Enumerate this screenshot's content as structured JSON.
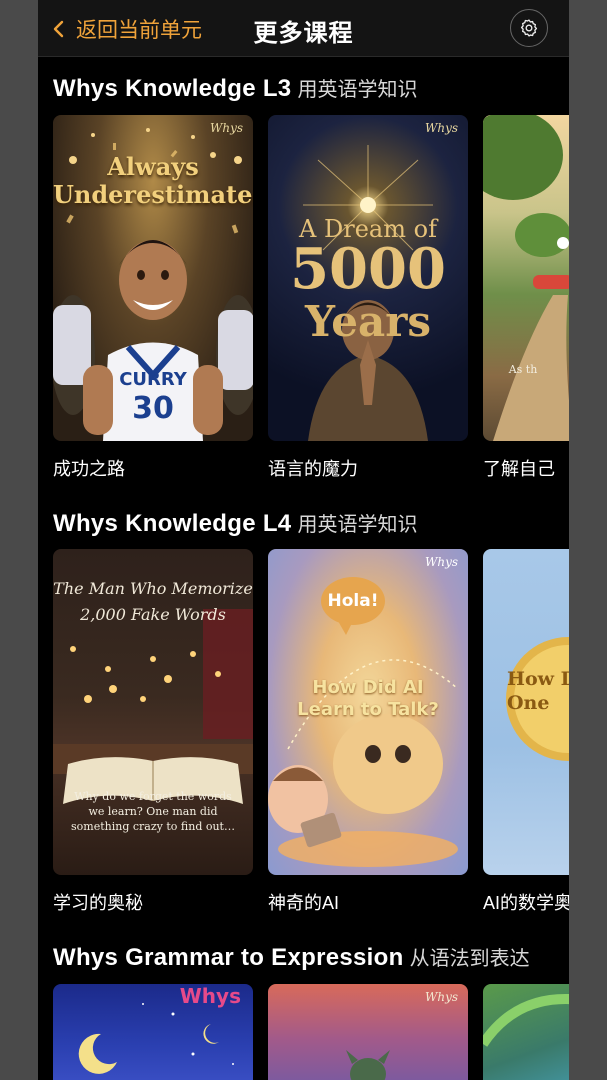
{
  "header": {
    "back_label": "返回当前单元",
    "title": "更多课程"
  },
  "sections": [
    {
      "title_en": "Whys Knowledge L3",
      "title_zh": "用英语学知识",
      "cards": [
        {
          "label": "成功之路",
          "art_title": "Always Underestimated",
          "jersey_name": "CURRY",
          "jersey_number": "30",
          "brand": "Whys"
        },
        {
          "label": "语言的魔力",
          "art_line1": "A Dream of",
          "art_line2": "5000",
          "art_line3": "Years",
          "brand": "Whys"
        },
        {
          "label": "了解自己",
          "art_caption": "As th"
        }
      ]
    },
    {
      "title_en": "Whys Knowledge L4",
      "title_zh": "用英语学知识",
      "cards": [
        {
          "label": "学习的奥秘",
          "art_title_line1": "The Man Who Memorize",
          "art_title_line2": "2,000 Fake Words",
          "art_caption": "Why do we forget the words we learn? One man did something crazy to find out…"
        },
        {
          "label": "神奇的AI",
          "art_bubble": "Hola!",
          "art_title": "How Did AI Learn to Talk?",
          "brand": "Whys"
        },
        {
          "label": "AI的数学奥",
          "art_title": "How Do One"
        }
      ]
    },
    {
      "title_en": "Whys Grammar to Expression",
      "title_zh": "从语法到表达",
      "cards": [
        {
          "brand": "Whys"
        },
        {
          "brand": "Whys"
        },
        {}
      ]
    }
  ],
  "colors": {
    "accent": "#f0a33a",
    "background": "#000000",
    "header_bg": "#141414"
  },
  "icons": {
    "back": "chevron-left-icon",
    "settings": "gear-icon"
  }
}
